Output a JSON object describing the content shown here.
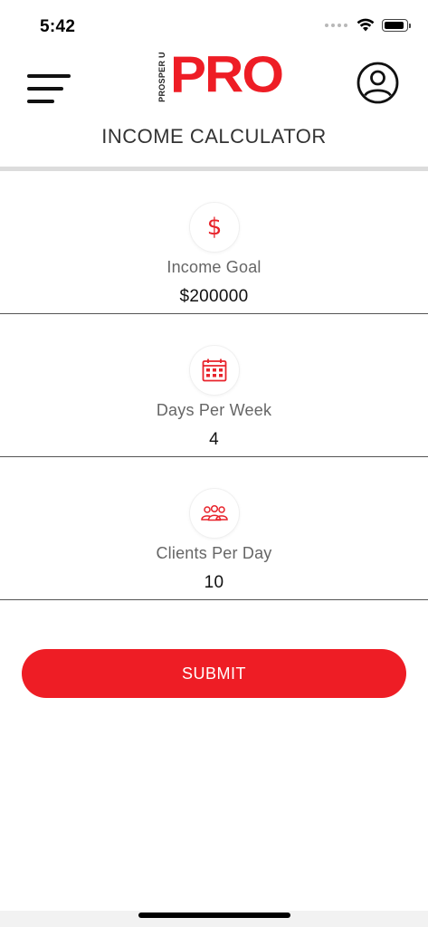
{
  "status_bar": {
    "time": "5:42",
    "battery_level": 0.9
  },
  "header": {
    "logo_small_text": "PROSPER U",
    "logo_main_text": "PRO",
    "title": "INCOME CALCULATOR",
    "menu_icon": "hamburger-menu-icon",
    "profile_icon": "user-circle-icon"
  },
  "fields": [
    {
      "icon": "dollar-icon",
      "icon_glyph": "$",
      "label": "Income Goal",
      "value": "$200000"
    },
    {
      "icon": "calendar-icon",
      "label": "Days Per Week",
      "value": "4"
    },
    {
      "icon": "people-icon",
      "label": "Clients Per Day",
      "value": "10"
    }
  ],
  "submit": {
    "label": "SUBMIT"
  },
  "colors": {
    "brand_red": "#ee1d25",
    "divider": "#dcdcdc"
  }
}
